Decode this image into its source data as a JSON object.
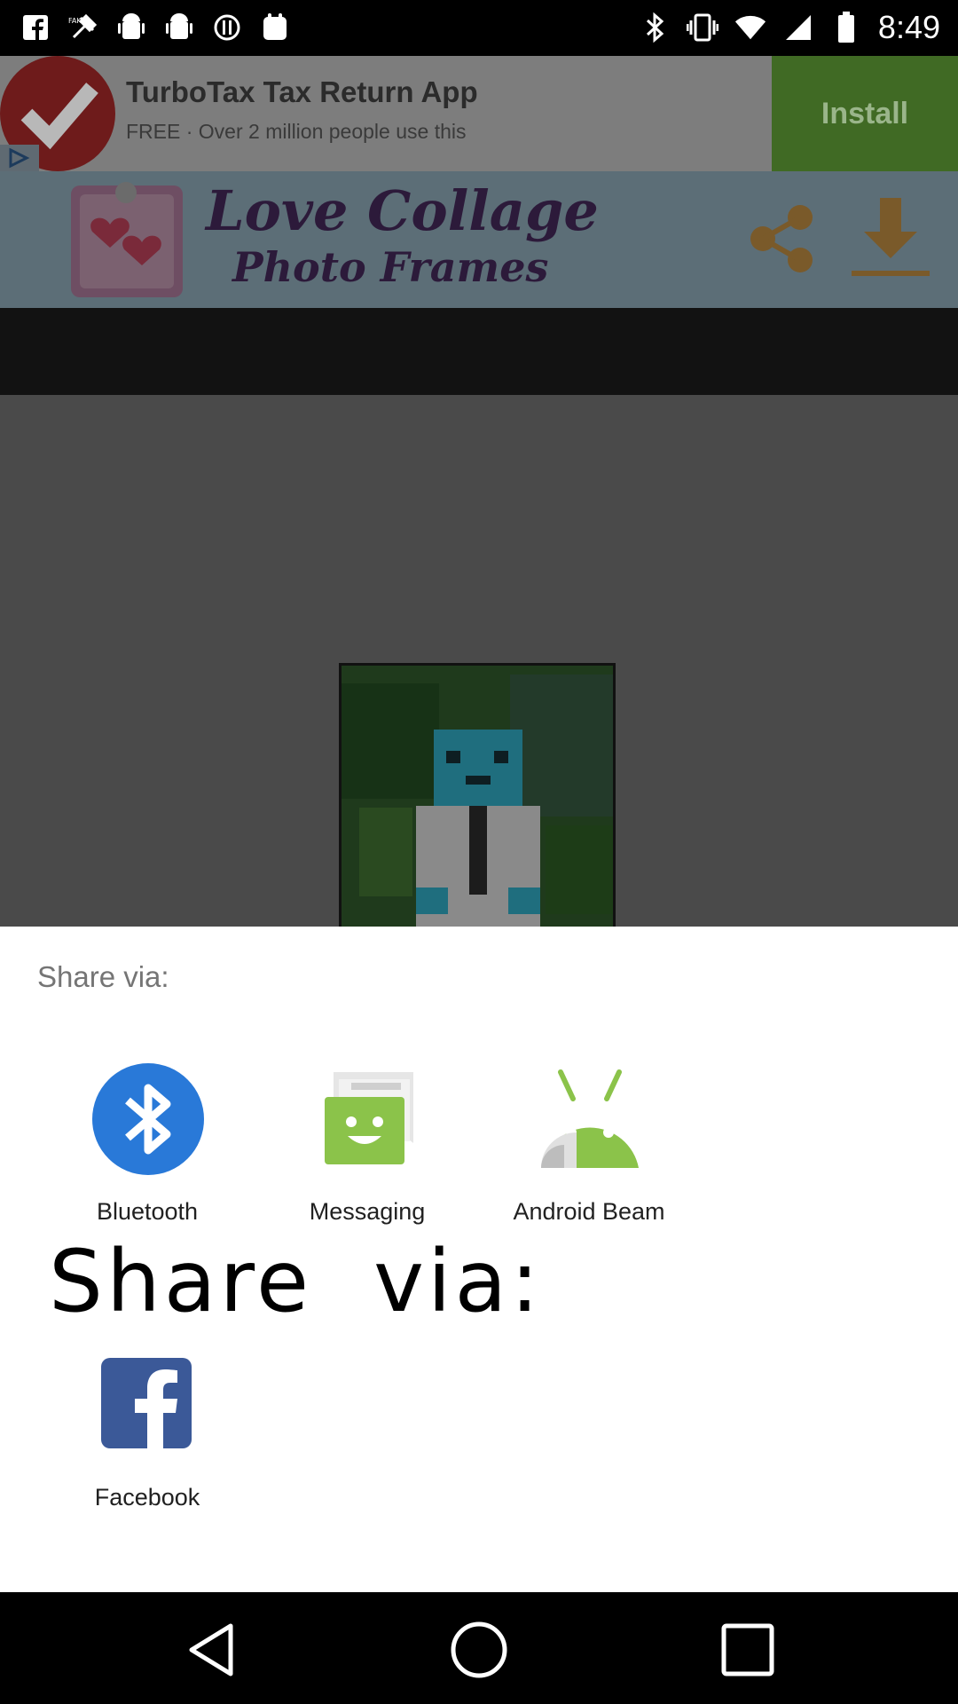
{
  "status_bar": {
    "time": "8:49",
    "left_icons": [
      "facebook-icon",
      "fake-gps-icon",
      "android-debug-icon",
      "android-debug-icon",
      "circle-icon",
      "calendar-icon"
    ],
    "right_icons": [
      "bluetooth-icon",
      "vibrate-icon",
      "wifi-icon",
      "signal-icon",
      "battery-icon"
    ]
  },
  "ad": {
    "title": "TurboTax Tax Return App",
    "subtitle": "FREE · Over 2 million people use this",
    "install_label": "Install",
    "colors": {
      "check": "#8a1a1a",
      "install_bg": "#406a24"
    }
  },
  "app_header": {
    "title_line1": "Love Collage",
    "title_line2": "Photo Frames",
    "logo_text": "Love",
    "icons": [
      "share-icon",
      "download-icon"
    ]
  },
  "share_sheet": {
    "heading": "Share via:",
    "overlay_label": "Share  via:",
    "targets": [
      {
        "name": "Bluetooth",
        "icon": "bluetooth-icon",
        "color": "#2979d8"
      },
      {
        "name": "Messaging",
        "icon": "messaging-icon",
        "color": "#8bc34a"
      },
      {
        "name": "Android Beam",
        "icon": "android-beam-icon",
        "color": "#8bc34a"
      },
      {
        "name": "Facebook",
        "icon": "facebook-icon",
        "color": "#3b5998"
      }
    ]
  },
  "nav_bar": {
    "buttons": [
      "back-icon",
      "home-icon",
      "recents-icon"
    ]
  }
}
